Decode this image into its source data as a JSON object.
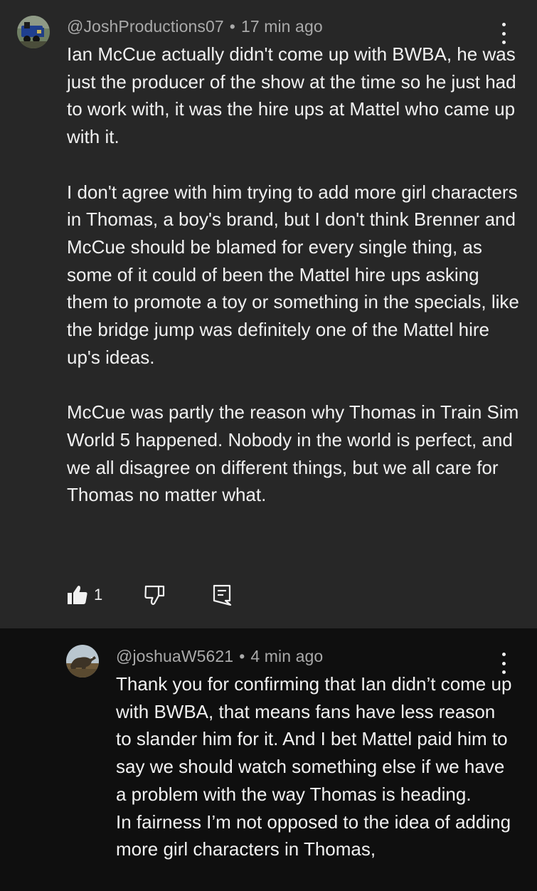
{
  "parent_comment": {
    "author": "@JoshProductions07",
    "separator": "•",
    "time": "17 min ago",
    "avatar_icon": "train-engine-avatar",
    "text": "Ian McCue actually didn't come up with BWBA, he was just the producer of the show at the time so he just had to work with, it was the hire ups at Mattel who came up with it.\n\nI don't agree with him trying to add more girl characters in Thomas, a boy's brand, but I don't think Brenner and McCue should be blamed for every single thing, as some of it could of been the Mattel hire ups asking them to promote a toy or something in the specials, like the bridge jump was definitely one of the Mattel hire up's ideas.\n\nMcCue was partly the reason why Thomas in Train Sim World 5 happened. Nobody in the world is perfect, and we all disagree on different things, but we all care for Thomas no matter what.",
    "like_count": "1",
    "icons": {
      "like": "thumbs-up-icon",
      "dislike": "thumbs-down-icon",
      "reply": "reply-comment-icon",
      "menu": "more-vertical-icon"
    }
  },
  "reply_comment": {
    "author": "@joshuaW5621",
    "separator": "•",
    "time": "4 min ago",
    "avatar_icon": "dinosaur-avatar",
    "text": "Thank you for confirming that Ian didn’t come up with BWBA, that means fans have less reason to slander him for it. And I bet Mattel paid him to say we should watch something else if we have a problem with the way Thomas is heading.\nIn fairness I’m not opposed to the idea of adding more girl characters in Thomas,"
  },
  "colors": {
    "highlight_background": "#272727",
    "page_background": "#0f0f0f",
    "primary_text": "#f1f1f1",
    "secondary_text": "#aaaaaa"
  }
}
